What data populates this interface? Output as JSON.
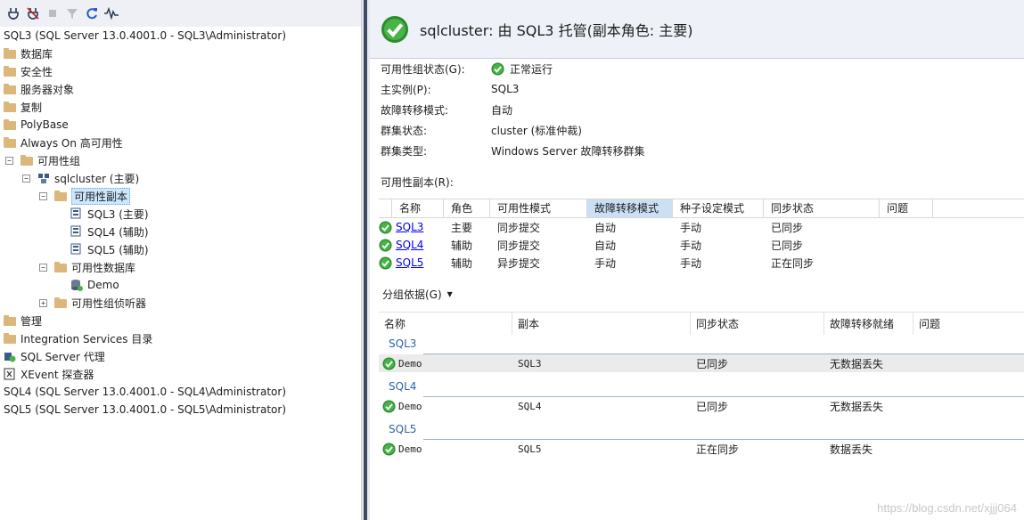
{
  "tree": {
    "root1": "SQL3 (SQL Server 13.0.4001.0 - SQL3\\Administrator)",
    "databases": "数据库",
    "security": "安全性",
    "server_objects": "服务器对象",
    "replication": "复制",
    "polybase": "PolyBase",
    "always_on": "Always On 高可用性",
    "ag_folder": "可用性组",
    "ag": "sqlcluster (主要)",
    "replicas_folder": "可用性副本",
    "replica1": "SQL3 (主要)",
    "replica2": "SQL4 (辅助)",
    "replica3": "SQL5 (辅助)",
    "db_folder": "可用性数据库",
    "db1": "Demo",
    "listeners": "可用性组侦听器",
    "management": "管理",
    "integration": "Integration Services 目录",
    "agent": "SQL Server 代理",
    "xevent": "XEvent 探查器",
    "root2": "SQL4 (SQL Server 13.0.4001.0 - SQL4\\Administrator)",
    "root3": "SQL5 (SQL Server 13.0.4001.0 - SQL5\\Administrator)"
  },
  "dashboard": {
    "title": "sqlcluster: 由 SQL3 托管(副本角色: 主要)",
    "props": [
      {
        "key": "可用性组状态(G):",
        "value": "正常运行"
      },
      {
        "key": "主实例(P):",
        "value": "SQL3"
      },
      {
        "key": "故障转移模式:",
        "value": "自动"
      },
      {
        "key": "群集状态:",
        "value": "cluster (标准仲裁)"
      },
      {
        "key": "群集类型:",
        "value": "Windows Server 故障转移群集"
      }
    ],
    "replicas_label": "可用性副本(R):",
    "replica_cols": [
      "名称",
      "角色",
      "可用性模式",
      "故障转移模式",
      "种子设定模式",
      "同步状态",
      "问题"
    ],
    "replica_rows": [
      [
        "SQL3",
        "主要",
        "同步提交",
        "自动",
        "手动",
        "已同步"
      ],
      [
        "SQL4",
        "辅助",
        "同步提交",
        "自动",
        "手动",
        "已同步"
      ],
      [
        "SQL5",
        "辅助",
        "异步提交",
        "手动",
        "手动",
        "正在同步"
      ]
    ],
    "group_by": "分组依据(G)",
    "db_cols": [
      "名称",
      "副本",
      "同步状态",
      "故障转移就绪",
      "问题"
    ],
    "groups": [
      {
        "name": "SQL3",
        "row": [
          "Demo",
          "SQL3",
          "已同步",
          "无数据丢失"
        ]
      },
      {
        "name": "SQL4",
        "row": [
          "Demo",
          "SQL4",
          "已同步",
          "无数据丢失"
        ]
      },
      {
        "name": "SQL5",
        "row": [
          "Demo",
          "SQL5",
          "正在同步",
          "数据丢失"
        ]
      }
    ]
  },
  "watermark": "https://blog.csdn.net/xjjj064",
  "colors": {
    "ok_green": "#3a9a2a",
    "link": "#0000ff",
    "selection": "#cce8ff"
  }
}
